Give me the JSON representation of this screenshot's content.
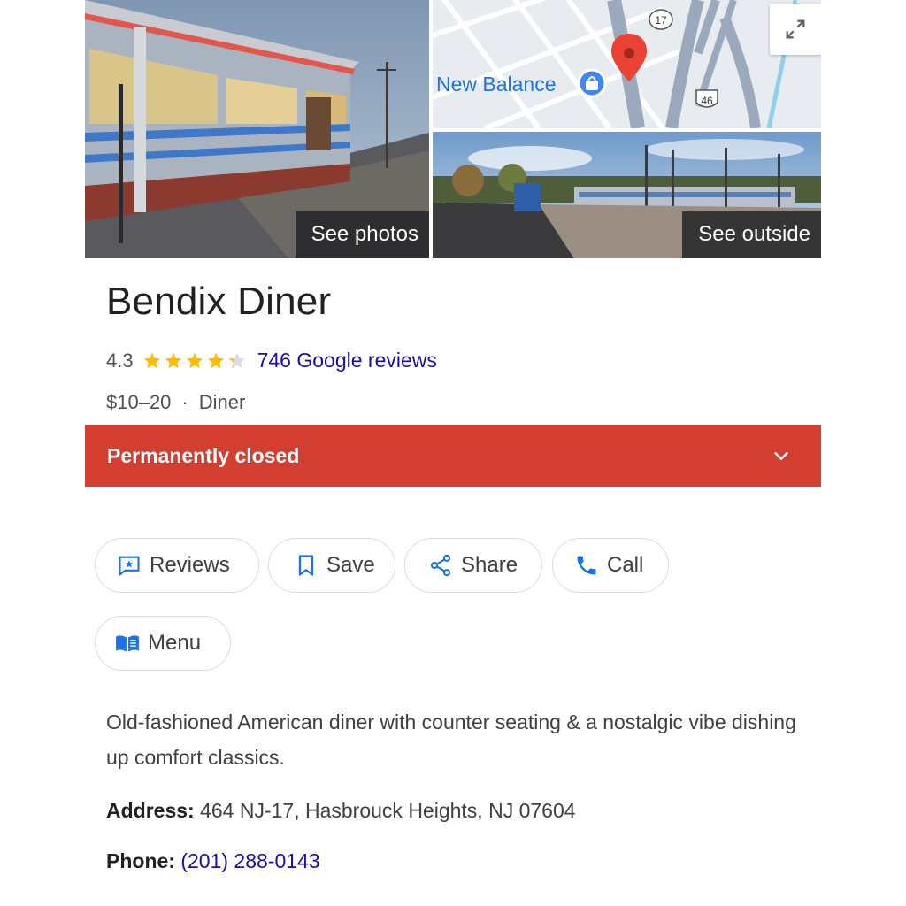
{
  "media": {
    "see_photos_label": "See photos",
    "see_outside_label": "See outside",
    "map": {
      "poi_label": "New Balance",
      "route_17": "17",
      "route_46": "46"
    }
  },
  "place": {
    "name": "Bendix Diner",
    "rating": "4.3",
    "stars_value": 4.3,
    "reviews_link": "746 Google reviews",
    "price": "$10–20",
    "separator": "·",
    "category": "Diner"
  },
  "status": {
    "label": "Permanently closed",
    "color": "#d23f31"
  },
  "actions": [
    {
      "label": "Reviews",
      "icon": "reviews-icon"
    },
    {
      "label": "Save",
      "icon": "bookmark-icon"
    },
    {
      "label": "Share",
      "icon": "share-icon"
    },
    {
      "label": "Call",
      "icon": "phone-icon"
    },
    {
      "label": "Menu",
      "icon": "menu-book-icon"
    }
  ],
  "description": "Old-fashioned American diner with counter seating & a nostalgic vibe dishing up comfort classics.",
  "address": {
    "label": "Address:",
    "value": " 464 NJ-17, Hasbrouck Heights, NJ 07604"
  },
  "phone": {
    "label": "Phone:",
    "value": "(201) 288-0143"
  },
  "colors": {
    "link": "#1a0dab",
    "star": "#fbbc04",
    "icon_blue": "#1a73e8"
  }
}
